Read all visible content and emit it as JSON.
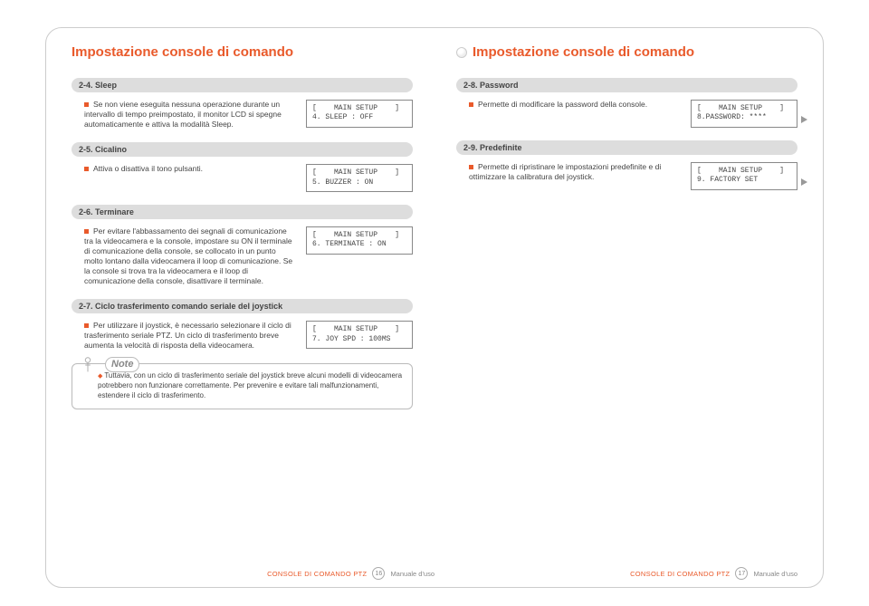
{
  "heading_left": "Impostazione console di comando",
  "heading_right": "Impostazione console di comando",
  "left": {
    "s24": {
      "pill": "2-4. Sleep",
      "text": "Se non viene eseguita nessuna operazione durante un intervallo di tempo preimpostato, il monitor LCD si spegne automaticamente e attiva la modalità Sleep.",
      "box": "[    MAIN SETUP    ]\n4. SLEEP : OFF"
    },
    "s25": {
      "pill": "2-5. Cicalino",
      "text": "Attiva o disattiva il tono pulsanti.",
      "box": "[    MAIN SETUP    ]\n5. BUZZER : ON"
    },
    "s26": {
      "pill": "2-6. Terminare",
      "text": "Per evitare l'abbassamento dei segnali di comunicazione tra la videocamera e la console, impostare su ON il terminale di comunicazione della console, se collocato in un punto molto lontano dalla videocamera il loop di comunicazione. Se la console si trova tra la videocamera e il loop di comunicazione della console, disattivare il terminale.",
      "box": "[    MAIN SETUP    ]\n6. TERMINATE : ON"
    },
    "s27": {
      "pill": "2-7. Ciclo trasferimento comando seriale del joystick",
      "text": "Per utilizzare il joystick, è necessario selezionare il ciclo di trasferimento seriale PTZ. Un ciclo di trasferimento breve aumenta la velocità di risposta della videocamera.",
      "box": "[    MAIN SETUP    ]\n7. JOY SPD : 100MS"
    },
    "note": {
      "label": "Note",
      "text": "Tuttavia, con un ciclo di trasferimento seriale del joystick breve alcuni modelli di videocamera potrebbero non funzionare correttamente. Per prevenire e evitare tali malfunzionamenti, estendere il ciclo di trasferimento."
    }
  },
  "right": {
    "s28": {
      "pill": "2-8. Password",
      "text": "Permette di modificare la password della console.",
      "box": "[    MAIN SETUP    ]\n8.PASSWORD: ****"
    },
    "s29": {
      "pill": "2-9. Predefinite",
      "text": "Permette di ripristinare le impostazioni predefinite e di ottimizzare la calibratura del joystick.",
      "box": "[    MAIN SETUP    ]\n9. FACTORY SET"
    }
  },
  "footer": {
    "product": "CONSOLE DI COMANDO PTZ",
    "page_left": "16",
    "page_right": "17",
    "manual": "Manuale d'uso"
  }
}
